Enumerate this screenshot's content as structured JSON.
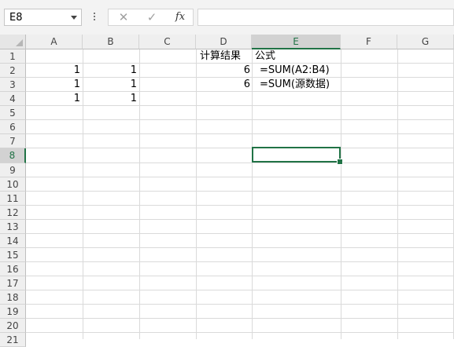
{
  "name_box": {
    "value": "E8"
  },
  "formula_bar": {
    "cancel_symbol": "✕",
    "enter_symbol": "✓",
    "fx_label": "fx",
    "content": ""
  },
  "columns": [
    "A",
    "B",
    "C",
    "D",
    "E",
    "F",
    "G"
  ],
  "selected_column": "E",
  "rows": [
    "1",
    "2",
    "3",
    "4",
    "5",
    "6",
    "7",
    "8",
    "9",
    "10",
    "11",
    "12",
    "13",
    "14",
    "15",
    "16",
    "17",
    "18",
    "19",
    "20",
    "21"
  ],
  "selected_row": "8",
  "cells": {
    "D1": "计算结果",
    "E1": "公式",
    "A2": "1",
    "B2": "1",
    "D2": "6",
    "E2": "=SUM(A2:B4)",
    "A3": "1",
    "B3": "1",
    "D3": "6",
    "E3": "=SUM(源数据)",
    "A4": "1",
    "B4": "1"
  },
  "accent_color": "#217346"
}
